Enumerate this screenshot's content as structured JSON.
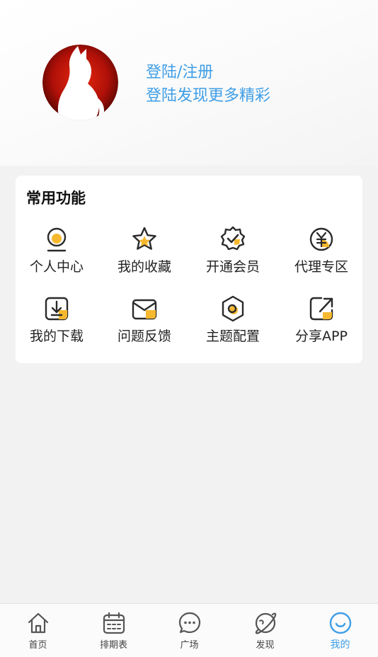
{
  "profile": {
    "login_title": "登陆/注册",
    "login_subtitle": "登陆发现更多精彩"
  },
  "functions": {
    "title": "常用功能",
    "items": [
      {
        "label": "个人中心",
        "icon": "user-center-icon"
      },
      {
        "label": "我的收藏",
        "icon": "star-icon"
      },
      {
        "label": "开通会员",
        "icon": "vip-badge-icon"
      },
      {
        "label": "代理专区",
        "icon": "yen-icon"
      },
      {
        "label": "我的下载",
        "icon": "download-icon"
      },
      {
        "label": "问题反馈",
        "icon": "mail-icon"
      },
      {
        "label": "主题配置",
        "icon": "theme-icon"
      },
      {
        "label": "分享APP",
        "icon": "share-icon"
      }
    ]
  },
  "tabbar": {
    "items": [
      {
        "label": "首页",
        "icon": "home-icon"
      },
      {
        "label": "排期表",
        "icon": "calendar-icon"
      },
      {
        "label": "广场",
        "icon": "chat-icon"
      },
      {
        "label": "发现",
        "icon": "planet-icon"
      },
      {
        "label": "我的",
        "icon": "smile-icon",
        "active": true
      }
    ]
  },
  "colors": {
    "accent": "#3f9ee6",
    "icon_fill": "#f5b82e",
    "icon_stroke": "#2a2a2a"
  }
}
